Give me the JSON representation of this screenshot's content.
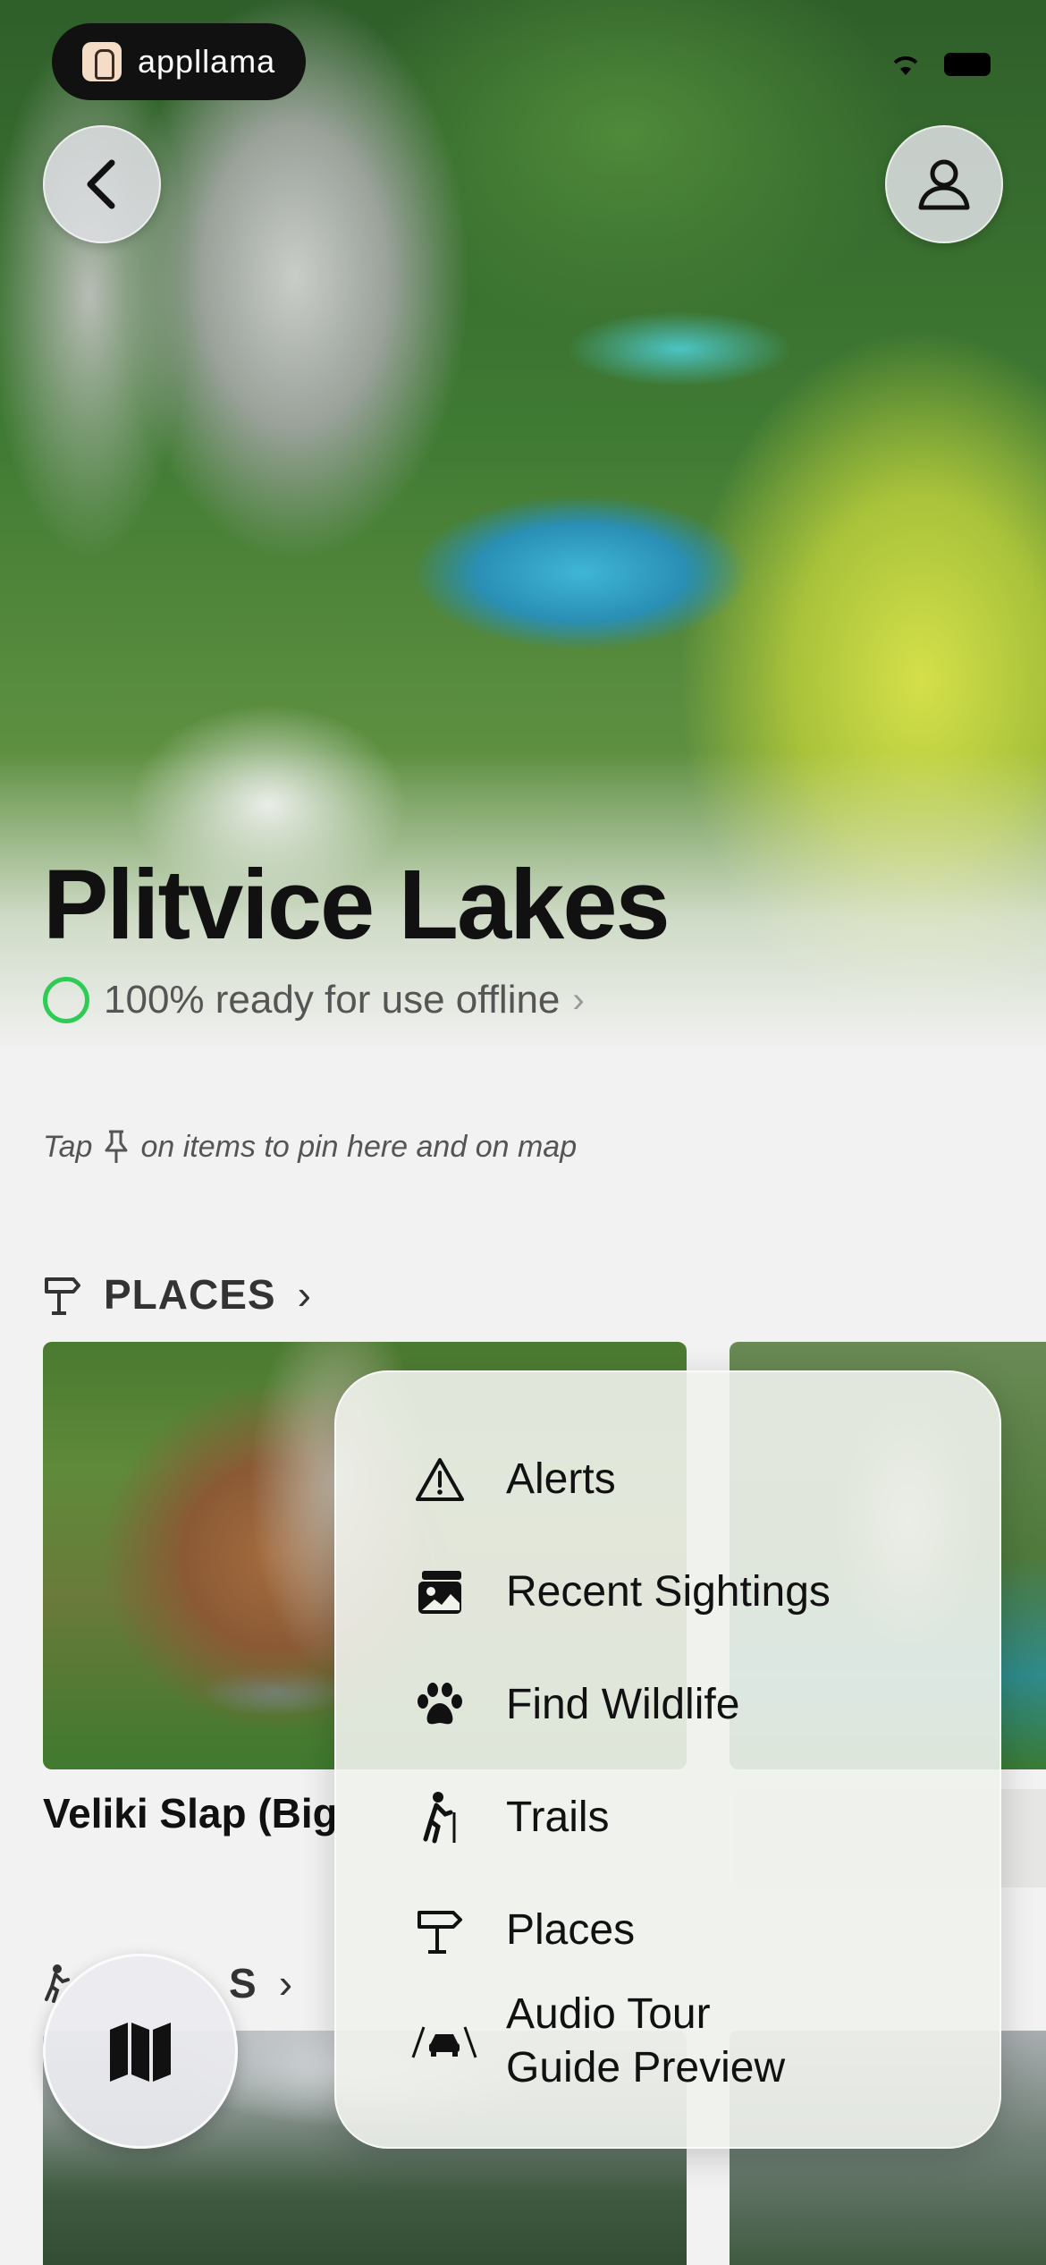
{
  "status_bar": {
    "app_badge": "appllama"
  },
  "header": {
    "title": "Plitvice Lakes",
    "offline_status": "100% ready for use offline"
  },
  "hint": {
    "before_icon": "Tap",
    "after_icon": "on items to pin here and on map"
  },
  "sections": {
    "places": {
      "label": "PLACES",
      "cards": [
        {
          "title": "Veliki Slap (Big"
        }
      ]
    },
    "trails": {
      "label_visible": "S"
    }
  },
  "menu": {
    "items": [
      {
        "label": "Alerts",
        "icon": "warning-icon"
      },
      {
        "label": "Recent Sightings",
        "icon": "photo-icon"
      },
      {
        "label": "Find Wildlife",
        "icon": "paw-icon"
      },
      {
        "label": "Trails",
        "icon": "hiker-icon"
      },
      {
        "label": "Places",
        "icon": "signpost-icon"
      },
      {
        "label": "Audio Tour",
        "label2": "Guide Preview",
        "icon": "car-road-icon"
      }
    ]
  },
  "colors": {
    "offline_ring": "#2ecc55",
    "background": "#f2f2f2"
  }
}
